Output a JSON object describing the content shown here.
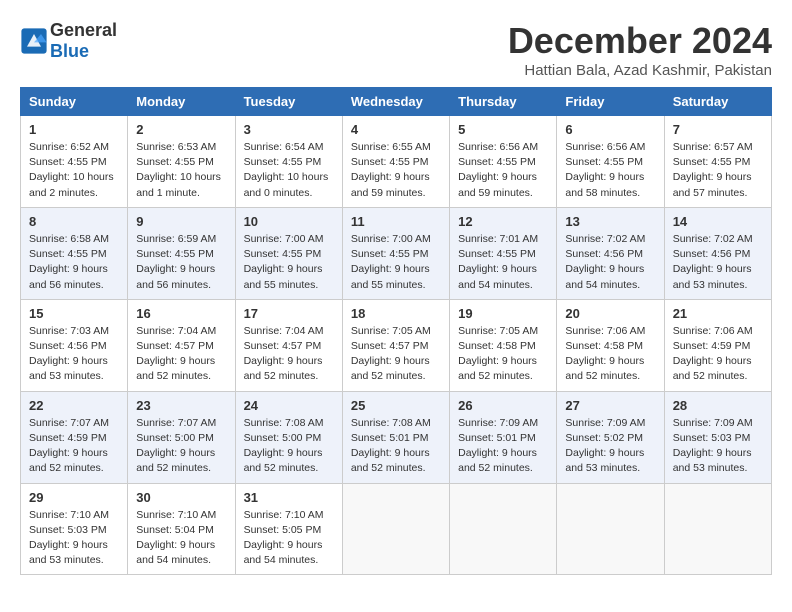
{
  "header": {
    "logo_general": "General",
    "logo_blue": "Blue",
    "month_year": "December 2024",
    "location": "Hattian Bala, Azad Kashmir, Pakistan"
  },
  "columns": [
    "Sunday",
    "Monday",
    "Tuesday",
    "Wednesday",
    "Thursday",
    "Friday",
    "Saturday"
  ],
  "weeks": [
    [
      {
        "day": "1",
        "sunrise": "6:52 AM",
        "sunset": "4:55 PM",
        "daylight": "10 hours and 2 minutes."
      },
      {
        "day": "2",
        "sunrise": "6:53 AM",
        "sunset": "4:55 PM",
        "daylight": "10 hours and 1 minute."
      },
      {
        "day": "3",
        "sunrise": "6:54 AM",
        "sunset": "4:55 PM",
        "daylight": "10 hours and 0 minutes."
      },
      {
        "day": "4",
        "sunrise": "6:55 AM",
        "sunset": "4:55 PM",
        "daylight": "9 hours and 59 minutes."
      },
      {
        "day": "5",
        "sunrise": "6:56 AM",
        "sunset": "4:55 PM",
        "daylight": "9 hours and 59 minutes."
      },
      {
        "day": "6",
        "sunrise": "6:56 AM",
        "sunset": "4:55 PM",
        "daylight": "9 hours and 58 minutes."
      },
      {
        "day": "7",
        "sunrise": "6:57 AM",
        "sunset": "4:55 PM",
        "daylight": "9 hours and 57 minutes."
      }
    ],
    [
      {
        "day": "8",
        "sunrise": "6:58 AM",
        "sunset": "4:55 PM",
        "daylight": "9 hours and 56 minutes."
      },
      {
        "day": "9",
        "sunrise": "6:59 AM",
        "sunset": "4:55 PM",
        "daylight": "9 hours and 56 minutes."
      },
      {
        "day": "10",
        "sunrise": "7:00 AM",
        "sunset": "4:55 PM",
        "daylight": "9 hours and 55 minutes."
      },
      {
        "day": "11",
        "sunrise": "7:00 AM",
        "sunset": "4:55 PM",
        "daylight": "9 hours and 55 minutes."
      },
      {
        "day": "12",
        "sunrise": "7:01 AM",
        "sunset": "4:55 PM",
        "daylight": "9 hours and 54 minutes."
      },
      {
        "day": "13",
        "sunrise": "7:02 AM",
        "sunset": "4:56 PM",
        "daylight": "9 hours and 54 minutes."
      },
      {
        "day": "14",
        "sunrise": "7:02 AM",
        "sunset": "4:56 PM",
        "daylight": "9 hours and 53 minutes."
      }
    ],
    [
      {
        "day": "15",
        "sunrise": "7:03 AM",
        "sunset": "4:56 PM",
        "daylight": "9 hours and 53 minutes."
      },
      {
        "day": "16",
        "sunrise": "7:04 AM",
        "sunset": "4:57 PM",
        "daylight": "9 hours and 52 minutes."
      },
      {
        "day": "17",
        "sunrise": "7:04 AM",
        "sunset": "4:57 PM",
        "daylight": "9 hours and 52 minutes."
      },
      {
        "day": "18",
        "sunrise": "7:05 AM",
        "sunset": "4:57 PM",
        "daylight": "9 hours and 52 minutes."
      },
      {
        "day": "19",
        "sunrise": "7:05 AM",
        "sunset": "4:58 PM",
        "daylight": "9 hours and 52 minutes."
      },
      {
        "day": "20",
        "sunrise": "7:06 AM",
        "sunset": "4:58 PM",
        "daylight": "9 hours and 52 minutes."
      },
      {
        "day": "21",
        "sunrise": "7:06 AM",
        "sunset": "4:59 PM",
        "daylight": "9 hours and 52 minutes."
      }
    ],
    [
      {
        "day": "22",
        "sunrise": "7:07 AM",
        "sunset": "4:59 PM",
        "daylight": "9 hours and 52 minutes."
      },
      {
        "day": "23",
        "sunrise": "7:07 AM",
        "sunset": "5:00 PM",
        "daylight": "9 hours and 52 minutes."
      },
      {
        "day": "24",
        "sunrise": "7:08 AM",
        "sunset": "5:00 PM",
        "daylight": "9 hours and 52 minutes."
      },
      {
        "day": "25",
        "sunrise": "7:08 AM",
        "sunset": "5:01 PM",
        "daylight": "9 hours and 52 minutes."
      },
      {
        "day": "26",
        "sunrise": "7:09 AM",
        "sunset": "5:01 PM",
        "daylight": "9 hours and 52 minutes."
      },
      {
        "day": "27",
        "sunrise": "7:09 AM",
        "sunset": "5:02 PM",
        "daylight": "9 hours and 53 minutes."
      },
      {
        "day": "28",
        "sunrise": "7:09 AM",
        "sunset": "5:03 PM",
        "daylight": "9 hours and 53 minutes."
      }
    ],
    [
      {
        "day": "29",
        "sunrise": "7:10 AM",
        "sunset": "5:03 PM",
        "daylight": "9 hours and 53 minutes."
      },
      {
        "day": "30",
        "sunrise": "7:10 AM",
        "sunset": "5:04 PM",
        "daylight": "9 hours and 54 minutes."
      },
      {
        "day": "31",
        "sunrise": "7:10 AM",
        "sunset": "5:05 PM",
        "daylight": "9 hours and 54 minutes."
      },
      null,
      null,
      null,
      null
    ]
  ]
}
